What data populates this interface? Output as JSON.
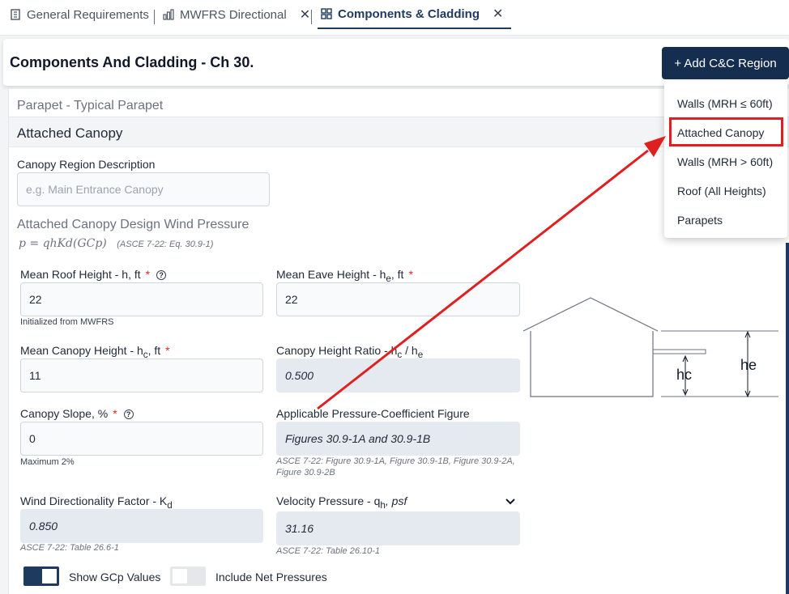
{
  "tabs": [
    {
      "label": "General Requirements",
      "icon": "building-icon"
    },
    {
      "label": "MWFRS Directional",
      "icon": "bar-chart-icon"
    },
    {
      "label": "Components & Cladding",
      "icon": "grid-icon"
    }
  ],
  "tab_close_glyph": "✕",
  "header": {
    "title": "Components And Cladding - Ch 30.",
    "add_button": "+ Add C&C Region"
  },
  "dropdown": {
    "items": [
      "Walls (MRH ≤ 60ft)",
      "Attached Canopy",
      "Walls (MRH > 60ft)",
      "Roof (All Heights)",
      "Parapets"
    ],
    "highlighted": "Attached Canopy"
  },
  "parapet_row": "Parapet - Typical Parapet",
  "section_title": "Attached Canopy",
  "canopy_desc": {
    "label": "Canopy Region Description",
    "placeholder": "e.g. Main Entrance Canopy"
  },
  "design_pressure": {
    "heading": "Attached Canopy Design Wind Pressure",
    "formula": "p = qhKd(GCp)",
    "reference": "(ASCE 7-22: Eq. 30.9-1)"
  },
  "fields": {
    "mean_roof_height": {
      "label": "Mean Roof Height - h, ft",
      "value": "22",
      "hint": "Initialized from MWFRS"
    },
    "mean_eave_height": {
      "label_main": "Mean Eave Height - h",
      "label_sub": "e",
      "label_unit": ", ft",
      "value": "22"
    },
    "mean_canopy_height": {
      "label_main": "Mean Canopy Height - h",
      "label_sub": "c",
      "label_unit": ", ft",
      "value": "11"
    },
    "canopy_height_ratio": {
      "label_a": "Canopy Height Ratio - h",
      "label_a_sub": "c",
      "label_b": " / h",
      "label_b_sub": "e",
      "value": "0.500"
    },
    "canopy_slope": {
      "label": "Canopy Slope, %",
      "value": "0",
      "hint": "Maximum 2%"
    },
    "pressure_figure": {
      "label": "Applicable Pressure-Coefficient Figure",
      "value": "Figures 30.9-1A and 30.9-1B",
      "reference": "ASCE 7-22: Figure 30.9-1A, Figure 30.9-1B, Figure 30.9-2A, Figure 30.9-2B"
    },
    "directionality": {
      "label_main": "Wind Directionality Factor - K",
      "label_sub": "d",
      "value": "0.850",
      "reference": "ASCE 7-22: Table 26.6-1"
    },
    "velocity_pressure": {
      "label_main": "Velocity Pressure - q",
      "label_sub": "h",
      "label_unit": ", psf",
      "value": "31.16",
      "reference": "ASCE 7-22: Table 26.10-1"
    }
  },
  "required_mark": "*",
  "help_glyph": "?",
  "toggles": {
    "show_gcp": {
      "label": "Show GCp Values",
      "on": true
    },
    "net_pressures": {
      "label": "Include Net Pressures",
      "on": false
    }
  },
  "diagram": {
    "hc_label": "hc",
    "he_label": "he"
  },
  "colors": {
    "primary": "#152d4f",
    "required": "#dc2626",
    "annotation": "#e02020"
  }
}
